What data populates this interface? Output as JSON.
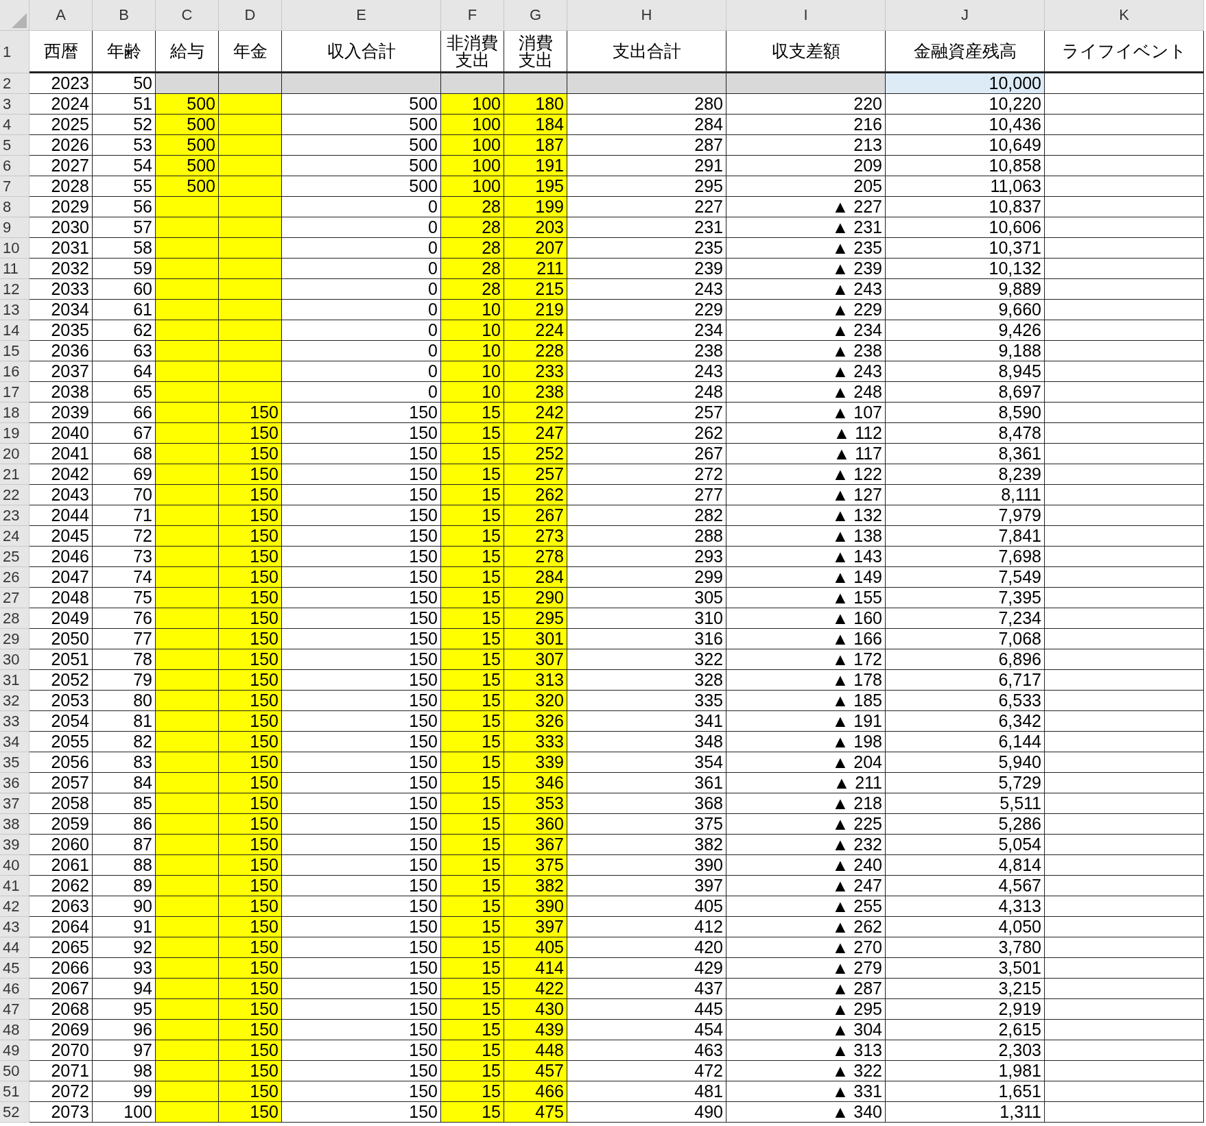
{
  "columns": [
    {
      "letter": "A",
      "header": [
        "西暦"
      ],
      "input": false
    },
    {
      "letter": "B",
      "header": [
        "年齢"
      ],
      "input": false
    },
    {
      "letter": "C",
      "header": [
        "給与"
      ],
      "input": true
    },
    {
      "letter": "D",
      "header": [
        "年金"
      ],
      "input": true
    },
    {
      "letter": "E",
      "header": [
        "収入合計"
      ],
      "input": false
    },
    {
      "letter": "F",
      "header": [
        "非消費",
        "支出"
      ],
      "input": true
    },
    {
      "letter": "G",
      "header": [
        "消費",
        "支出"
      ],
      "input": true
    },
    {
      "letter": "H",
      "header": [
        "支出合計"
      ],
      "input": false
    },
    {
      "letter": "I",
      "header": [
        "収支差額"
      ],
      "input": false
    },
    {
      "letter": "J",
      "header": [
        "金融資産残高"
      ],
      "input": false
    },
    {
      "letter": "K",
      "header": [
        "ライフイベント"
      ],
      "input": false
    }
  ],
  "header_row": "1",
  "rows": [
    {
      "num": "2",
      "kind": "initial",
      "cells": [
        "2023",
        "50",
        null,
        null,
        null,
        null,
        null,
        null,
        null,
        "10,000",
        null
      ]
    },
    {
      "num": "3",
      "kind": "data",
      "cells": [
        "2024",
        "51",
        "500",
        null,
        "500",
        "100",
        "180",
        "280",
        "220",
        "10,220",
        null
      ]
    },
    {
      "num": "4",
      "kind": "data",
      "cells": [
        "2025",
        "52",
        "500",
        null,
        "500",
        "100",
        "184",
        "284",
        "216",
        "10,436",
        null
      ]
    },
    {
      "num": "5",
      "kind": "data",
      "cells": [
        "2026",
        "53",
        "500",
        null,
        "500",
        "100",
        "187",
        "287",
        "213",
        "10,649",
        null
      ]
    },
    {
      "num": "6",
      "kind": "data",
      "cells": [
        "2027",
        "54",
        "500",
        null,
        "500",
        "100",
        "191",
        "291",
        "209",
        "10,858",
        null
      ]
    },
    {
      "num": "7",
      "kind": "data",
      "cells": [
        "2028",
        "55",
        "500",
        null,
        "500",
        "100",
        "195",
        "295",
        "205",
        "11,063",
        null
      ]
    },
    {
      "num": "8",
      "kind": "data",
      "cells": [
        "2029",
        "56",
        null,
        null,
        "0",
        "28",
        "199",
        "227",
        "▲ 227",
        "10,837",
        null
      ]
    },
    {
      "num": "9",
      "kind": "data",
      "cells": [
        "2030",
        "57",
        null,
        null,
        "0",
        "28",
        "203",
        "231",
        "▲ 231",
        "10,606",
        null
      ]
    },
    {
      "num": "10",
      "kind": "data",
      "cells": [
        "2031",
        "58",
        null,
        null,
        "0",
        "28",
        "207",
        "235",
        "▲ 235",
        "10,371",
        null
      ]
    },
    {
      "num": "11",
      "kind": "data",
      "cells": [
        "2032",
        "59",
        null,
        null,
        "0",
        "28",
        "211",
        "239",
        "▲ 239",
        "10,132",
        null
      ]
    },
    {
      "num": "12",
      "kind": "data",
      "cells": [
        "2033",
        "60",
        null,
        null,
        "0",
        "28",
        "215",
        "243",
        "▲ 243",
        "9,889",
        null
      ]
    },
    {
      "num": "13",
      "kind": "data",
      "cells": [
        "2034",
        "61",
        null,
        null,
        "0",
        "10",
        "219",
        "229",
        "▲ 229",
        "9,660",
        null
      ]
    },
    {
      "num": "14",
      "kind": "data",
      "cells": [
        "2035",
        "62",
        null,
        null,
        "0",
        "10",
        "224",
        "234",
        "▲ 234",
        "9,426",
        null
      ]
    },
    {
      "num": "15",
      "kind": "data",
      "cells": [
        "2036",
        "63",
        null,
        null,
        "0",
        "10",
        "228",
        "238",
        "▲ 238",
        "9,188",
        null
      ]
    },
    {
      "num": "16",
      "kind": "data",
      "cells": [
        "2037",
        "64",
        null,
        null,
        "0",
        "10",
        "233",
        "243",
        "▲ 243",
        "8,945",
        null
      ]
    },
    {
      "num": "17",
      "kind": "data",
      "cells": [
        "2038",
        "65",
        null,
        null,
        "0",
        "10",
        "238",
        "248",
        "▲ 248",
        "8,697",
        null
      ]
    },
    {
      "num": "18",
      "kind": "data",
      "cells": [
        "2039",
        "66",
        null,
        "150",
        "150",
        "15",
        "242",
        "257",
        "▲ 107",
        "8,590",
        null
      ]
    },
    {
      "num": "19",
      "kind": "data",
      "cells": [
        "2040",
        "67",
        null,
        "150",
        "150",
        "15",
        "247",
        "262",
        "▲ 112",
        "8,478",
        null
      ]
    },
    {
      "num": "20",
      "kind": "data",
      "cells": [
        "2041",
        "68",
        null,
        "150",
        "150",
        "15",
        "252",
        "267",
        "▲ 117",
        "8,361",
        null
      ]
    },
    {
      "num": "21",
      "kind": "data",
      "cells": [
        "2042",
        "69",
        null,
        "150",
        "150",
        "15",
        "257",
        "272",
        "▲ 122",
        "8,239",
        null
      ]
    },
    {
      "num": "22",
      "kind": "data",
      "cells": [
        "2043",
        "70",
        null,
        "150",
        "150",
        "15",
        "262",
        "277",
        "▲ 127",
        "8,111",
        null
      ]
    },
    {
      "num": "23",
      "kind": "data",
      "cells": [
        "2044",
        "71",
        null,
        "150",
        "150",
        "15",
        "267",
        "282",
        "▲ 132",
        "7,979",
        null
      ]
    },
    {
      "num": "24",
      "kind": "data",
      "cells": [
        "2045",
        "72",
        null,
        "150",
        "150",
        "15",
        "273",
        "288",
        "▲ 138",
        "7,841",
        null
      ]
    },
    {
      "num": "25",
      "kind": "data",
      "cells": [
        "2046",
        "73",
        null,
        "150",
        "150",
        "15",
        "278",
        "293",
        "▲ 143",
        "7,698",
        null
      ]
    },
    {
      "num": "26",
      "kind": "data",
      "cells": [
        "2047",
        "74",
        null,
        "150",
        "150",
        "15",
        "284",
        "299",
        "▲ 149",
        "7,549",
        null
      ]
    },
    {
      "num": "27",
      "kind": "data",
      "cells": [
        "2048",
        "75",
        null,
        "150",
        "150",
        "15",
        "290",
        "305",
        "▲ 155",
        "7,395",
        null
      ]
    },
    {
      "num": "28",
      "kind": "data",
      "cells": [
        "2049",
        "76",
        null,
        "150",
        "150",
        "15",
        "295",
        "310",
        "▲ 160",
        "7,234",
        null
      ]
    },
    {
      "num": "29",
      "kind": "data",
      "cells": [
        "2050",
        "77",
        null,
        "150",
        "150",
        "15",
        "301",
        "316",
        "▲ 166",
        "7,068",
        null
      ]
    },
    {
      "num": "30",
      "kind": "data",
      "cells": [
        "2051",
        "78",
        null,
        "150",
        "150",
        "15",
        "307",
        "322",
        "▲ 172",
        "6,896",
        null
      ]
    },
    {
      "num": "31",
      "kind": "data",
      "cells": [
        "2052",
        "79",
        null,
        "150",
        "150",
        "15",
        "313",
        "328",
        "▲ 178",
        "6,717",
        null
      ]
    },
    {
      "num": "32",
      "kind": "data",
      "cells": [
        "2053",
        "80",
        null,
        "150",
        "150",
        "15",
        "320",
        "335",
        "▲ 185",
        "6,533",
        null
      ]
    },
    {
      "num": "33",
      "kind": "data",
      "cells": [
        "2054",
        "81",
        null,
        "150",
        "150",
        "15",
        "326",
        "341",
        "▲ 191",
        "6,342",
        null
      ]
    },
    {
      "num": "34",
      "kind": "data",
      "cells": [
        "2055",
        "82",
        null,
        "150",
        "150",
        "15",
        "333",
        "348",
        "▲ 198",
        "6,144",
        null
      ]
    },
    {
      "num": "35",
      "kind": "data",
      "cells": [
        "2056",
        "83",
        null,
        "150",
        "150",
        "15",
        "339",
        "354",
        "▲ 204",
        "5,940",
        null
      ]
    },
    {
      "num": "36",
      "kind": "data",
      "cells": [
        "2057",
        "84",
        null,
        "150",
        "150",
        "15",
        "346",
        "361",
        "▲ 211",
        "5,729",
        null
      ]
    },
    {
      "num": "37",
      "kind": "data",
      "cells": [
        "2058",
        "85",
        null,
        "150",
        "150",
        "15",
        "353",
        "368",
        "▲ 218",
        "5,511",
        null
      ]
    },
    {
      "num": "38",
      "kind": "data",
      "cells": [
        "2059",
        "86",
        null,
        "150",
        "150",
        "15",
        "360",
        "375",
        "▲ 225",
        "5,286",
        null
      ]
    },
    {
      "num": "39",
      "kind": "data",
      "cells": [
        "2060",
        "87",
        null,
        "150",
        "150",
        "15",
        "367",
        "382",
        "▲ 232",
        "5,054",
        null
      ]
    },
    {
      "num": "40",
      "kind": "data",
      "cells": [
        "2061",
        "88",
        null,
        "150",
        "150",
        "15",
        "375",
        "390",
        "▲ 240",
        "4,814",
        null
      ]
    },
    {
      "num": "41",
      "kind": "data",
      "cells": [
        "2062",
        "89",
        null,
        "150",
        "150",
        "15",
        "382",
        "397",
        "▲ 247",
        "4,567",
        null
      ]
    },
    {
      "num": "42",
      "kind": "data",
      "cells": [
        "2063",
        "90",
        null,
        "150",
        "150",
        "15",
        "390",
        "405",
        "▲ 255",
        "4,313",
        null
      ]
    },
    {
      "num": "43",
      "kind": "data",
      "cells": [
        "2064",
        "91",
        null,
        "150",
        "150",
        "15",
        "397",
        "412",
        "▲ 262",
        "4,050",
        null
      ]
    },
    {
      "num": "44",
      "kind": "data",
      "cells": [
        "2065",
        "92",
        null,
        "150",
        "150",
        "15",
        "405",
        "420",
        "▲ 270",
        "3,780",
        null
      ]
    },
    {
      "num": "45",
      "kind": "data",
      "cells": [
        "2066",
        "93",
        null,
        "150",
        "150",
        "15",
        "414",
        "429",
        "▲ 279",
        "3,501",
        null
      ]
    },
    {
      "num": "46",
      "kind": "data",
      "cells": [
        "2067",
        "94",
        null,
        "150",
        "150",
        "15",
        "422",
        "437",
        "▲ 287",
        "3,215",
        null
      ]
    },
    {
      "num": "47",
      "kind": "data",
      "cells": [
        "2068",
        "95",
        null,
        "150",
        "150",
        "15",
        "430",
        "445",
        "▲ 295",
        "2,919",
        null
      ]
    },
    {
      "num": "48",
      "kind": "data",
      "cells": [
        "2069",
        "96",
        null,
        "150",
        "150",
        "15",
        "439",
        "454",
        "▲ 304",
        "2,615",
        null
      ]
    },
    {
      "num": "49",
      "kind": "data",
      "cells": [
        "2070",
        "97",
        null,
        "150",
        "150",
        "15",
        "448",
        "463",
        "▲ 313",
        "2,303",
        null
      ]
    },
    {
      "num": "50",
      "kind": "data",
      "cells": [
        "2071",
        "98",
        null,
        "150",
        "150",
        "15",
        "457",
        "472",
        "▲ 322",
        "1,981",
        null
      ]
    },
    {
      "num": "51",
      "kind": "data",
      "cells": [
        "2072",
        "99",
        null,
        "150",
        "150",
        "15",
        "466",
        "481",
        "▲ 331",
        "1,651",
        null
      ]
    },
    {
      "num": "52",
      "kind": "data",
      "cells": [
        "2073",
        "100",
        null,
        "150",
        "150",
        "15",
        "475",
        "490",
        "▲ 340",
        "1,311",
        null
      ]
    }
  ]
}
